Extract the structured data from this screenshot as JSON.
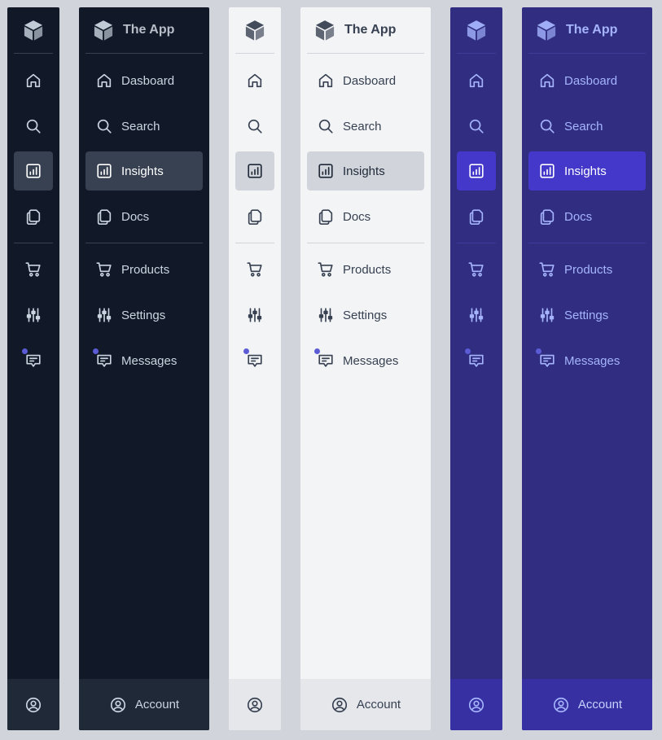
{
  "app": {
    "name": "The App"
  },
  "nav": {
    "dashboard": "Dasboard",
    "search": "Search",
    "insights": "Insights",
    "docs": "Docs",
    "products": "Products",
    "settings": "Settings",
    "messages": "Messages"
  },
  "account": {
    "label": "Account"
  },
  "active_item": "insights",
  "themes": {
    "dark": {
      "background": "#111827",
      "active": "#374151",
      "footer": "#1f2937"
    },
    "light": {
      "background": "#f3f4f6",
      "active": "#d1d5db",
      "footer": "#e5e7eb"
    },
    "indigo": {
      "background": "#312e81",
      "active": "#4338ca",
      "footer": "#3730a3"
    }
  },
  "notification_dot_color": "#5b5bd6",
  "icons": {
    "logo": "cube-icon",
    "dashboard": "home-icon",
    "search": "search-icon",
    "insights": "bar-chart-icon",
    "docs": "copy-icon",
    "products": "shopping-cart-icon",
    "settings": "sliders-icon",
    "messages": "message-icon",
    "account": "user-circle-icon"
  }
}
